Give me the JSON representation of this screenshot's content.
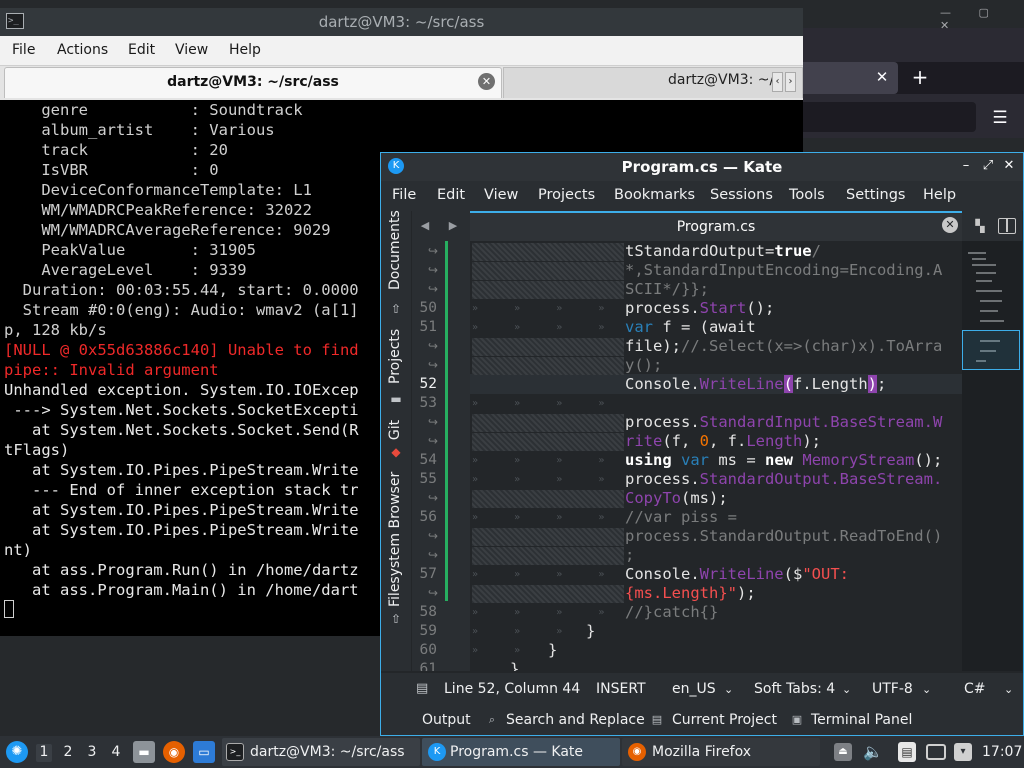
{
  "colors": {
    "accent": "#3daee9",
    "terminal_bg": "#000000",
    "error_red": "#ef2929",
    "kate_bg": "#232629",
    "string_red": "#f44f4f",
    "number_orange": "#f67400",
    "function_purple": "#8e44ad",
    "type_blue": "#2980b9"
  },
  "terminal": {
    "title": "dartz@VM3: ~/src/ass",
    "icon": "terminal-icon",
    "menu": [
      "File",
      "Actions",
      "Edit",
      "View",
      "Help"
    ],
    "tabs": [
      {
        "label": "dartz@VM3: ~/src/ass"
      },
      {
        "label": "dartz@VM3: ~/"
      }
    ],
    "lines": [
      "    genre           : Soundtrack",
      "    album_artist    : Various",
      "    track           : 20",
      "    IsVBR           : 0",
      "    DeviceConformanceTemplate: L1",
      "    WM/WMADRCPeakReference: 32022",
      "    WM/WMADRCAverageReference: 9029",
      "    PeakValue       : 31905",
      "    AverageLevel    : 9339",
      "  Duration: 00:03:55.44, start: 0.0000",
      "  Stream #0:0(eng): Audio: wmav2 (a[1]",
      "p, 128 kb/s",
      "[NULL @ 0x55d63886c140] Unable to find",
      "pipe:: Invalid argument",
      "Unhandled exception. System.IO.IOExcep",
      " ---> System.Net.Sockets.SocketExcepti",
      "   at System.Net.Sockets.Socket.Send(R",
      "tFlags)",
      "   at System.IO.Pipes.PipeStream.Write",
      "   --- End of inner exception stack tr",
      "   at System.IO.Pipes.PipeStream.Write",
      "   at System.IO.Pipes.PipeStream.Write",
      "nt)",
      "   at ass.Program.Run() in /home/dartz",
      "   at ass.Program.Main() in /home/dart"
    ],
    "red_lines": [
      12,
      13
    ]
  },
  "kate": {
    "title": "Program.cs  — Kate",
    "icon": "kate-icon",
    "menu": [
      "File",
      "Edit",
      "View",
      "Projects",
      "Bookmarks",
      "Sessions",
      "Tools",
      "Settings",
      "Help"
    ],
    "sidebar": [
      "Documents",
      "Projects",
      "Git",
      "Filesystem Browser"
    ],
    "tab": "Program.cs",
    "line_numbers": {
      "n50": "50",
      "n51": "51",
      "n52": "52",
      "n53": "53",
      "n54": "54",
      "n55": "55",
      "n56": "56",
      "n57": "57",
      "n58": "58",
      "n59": "59",
      "n60": "60",
      "n61": "61"
    },
    "code": {
      "l0": "tStandardOutput=",
      "l0b": "true",
      "l0c": "/",
      "l1": "*,StandardInputEncoding=Encoding.A",
      "l2": "SCII*/}};",
      "l3a": "process.",
      "l3b": "Start",
      "l3c": "();",
      "l4a": "var",
      "l4b": " f = (await",
      "l5a": "file);",
      "l5b": "//.Select(x=>(char)x).ToArra",
      "l6": "y();",
      "l7a": "Console.",
      "l7b": "WriteLine",
      "l7c": "(",
      "l7d": "f.Length",
      "l7e": ")",
      "l7f": ";",
      "l8a": "process.",
      "l8b": "StandardInput.BaseStream.W",
      "l9a": "rite",
      "l9b": "(f, ",
      "l9c": "0",
      "l9d": ", f.",
      "l9e": "Length",
      "l9f": ");",
      "l10a": "using",
      "l10b": " ",
      "l10c": "var",
      "l10d": " ms = ",
      "l10e": "new",
      "l10f": " ",
      "l10g": "MemoryStream",
      "l10h": "();",
      "l11a": "process.",
      "l11b": "StandardOutput.BaseStream.",
      "l12a": "CopyTo",
      "l12b": "(ms);",
      "l13": "//var piss =",
      "l14": "process.StandardOutput.ReadToEnd()",
      "l15": ";",
      "l16a": "Console.",
      "l16b": "WriteLine",
      "l16c": "($",
      "l16d": "\"OUT:",
      "l17a": "{ms.Length}\"",
      "l17b": ");",
      "l18": "//}catch{}",
      "l19": "}",
      "l20": "}",
      "l21": "}"
    },
    "status": {
      "position": "Line 52, Column 44",
      "mode": "INSERT",
      "language": "en_US",
      "indent": "Soft Tabs: 4",
      "encoding": "UTF-8",
      "syntax": "C#"
    },
    "toolviews": [
      "Output",
      "Search and Replace",
      "Current Project",
      "Terminal Panel"
    ]
  },
  "taskbar": {
    "workspaces": [
      "1",
      "2",
      "3",
      "4"
    ],
    "tasks": [
      {
        "label": "dartz@VM3: ~/src/ass"
      },
      {
        "label": "Program.cs — Kate"
      },
      {
        "label": "Mozilla Firefox"
      }
    ],
    "clock": "17:07"
  }
}
